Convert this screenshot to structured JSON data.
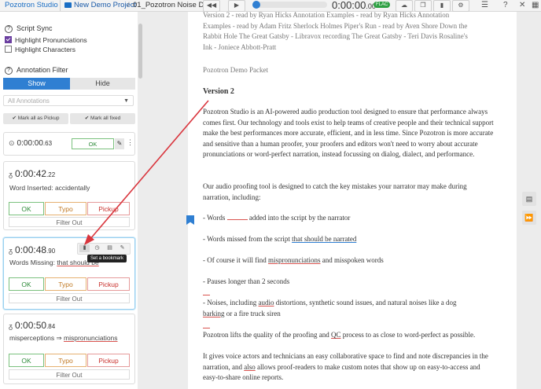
{
  "topbar": {
    "brand": "Pozotron Studio",
    "project": "New Demo Project",
    "separator": "/",
    "filename": "01_Pozotron Noise De...",
    "time_main": "0:00:00",
    "time_fraction": ".00",
    "format_badge": "FLAC"
  },
  "sidebar": {
    "script_sync": {
      "title": "Script Sync",
      "options": [
        {
          "label": "Highlight Pronunciations",
          "checked": true
        },
        {
          "label": "Highlight Characters",
          "checked": false
        }
      ]
    },
    "annotation_filter": {
      "title": "Annotation Filter",
      "show_label": "Show",
      "hide_label": "Hide",
      "dropdown_value": "All Annotations",
      "mark_pickup_label": "Mark all as Pickup",
      "mark_fixed_label": "Mark all fixed"
    },
    "cards": [
      {
        "time": "0:00:00",
        "frac": ".63",
        "ok_label": "OK"
      },
      {
        "time": "0:00:42",
        "frac": ".22",
        "text": "Word Inserted: accidentally",
        "ok": "OK",
        "typo": "Typo",
        "pickup": "Pickup",
        "filter": "Filter Out"
      },
      {
        "time": "0:00:48",
        "frac": ".90",
        "text_prefix": "Words Missing: ",
        "text_highlight": "that should be",
        "ok": "OK",
        "typo": "Typo",
        "pickup": "Pickup",
        "filter": "Filter Out",
        "tooltip": "Set a bookmark"
      },
      {
        "time": "0:00:50",
        "frac": ".84",
        "text_before": "misperceptions ",
        "arrow": "⇒",
        "text_highlight": "mispronunciations",
        "ok": "OK",
        "typo": "Typo",
        "pickup": "Pickup",
        "filter": "Filter Out"
      }
    ]
  },
  "document": {
    "header_lines": [
      "Version 2 - read by Ryan Hicks Annotation Examples - read by Ryan Hicks Annotation",
      "Examples - read by Adam Fritz Sherlock Holmes Piper's Run - read by Aven Shore Down the",
      "Rabbit Hole The Great Gatsby - Libravox recording The Great Gatsby - Teri Davis Rosaline's",
      "Ink - Joniece Abbott-Pratt"
    ],
    "packet_title": "Pozotron Demo Packet",
    "version_heading": "Version 2",
    "para1": "Pozotron Studio is an AI-powered audio production tool designed to ensure that performance always comes first. Our technology and tools exist to help teams of creative people and their technical support make the best performances more accurate, efficient, and in less time. Since Pozotron is more accurate and sensitive than a human proofer, your proofers and editors won't need to worry about accurate pronunciations or word-perfect narration, instead focussing on dialog, dialect, and performance.",
    "para2": "Our audio proofing tool is designed to catch the key mistakes your narrator may make during narration, including:",
    "bullet1_a": "- Words",
    "bullet1_b": " added into the script by the narrator",
    "bullet2_a": "- Words missed from the script ",
    "bullet2_b": "that should be narrated",
    "bullet3_a": "- Of course it will find ",
    "bullet3_b": "mispronunciations",
    "bullet3_c": " and misspoken words",
    "bullet4": "- Pauses longer than 2 seconds",
    "bullet5_a": "- Noises, including ",
    "bullet5_b": "audio",
    "bullet5_c": " distortions, synthetic sound issues, and natural noises like a dog",
    "bullet5_d": "barking",
    "bullet5_e": " or a fire truck siren",
    "para3_a": "Pozotron lifts the quality of the proofing and ",
    "para3_b": "QC",
    "para3_c": " process to as close to word-perfect as possible.",
    "para4_a": "It gives voice actors and technicians an easy collaborative space to find and note discrepancies in the narration, and ",
    "para4_b": "also",
    "para4_c": " allows proof-readers to make custom notes that show up on easy-to-access and easy-to-share online reports."
  },
  "colors": {
    "accent": "#2f7fd2",
    "ok": "#2e8b3a",
    "typo": "#c07720",
    "pickup": "#c9302c",
    "annotation_arrow": "#d9363e"
  }
}
